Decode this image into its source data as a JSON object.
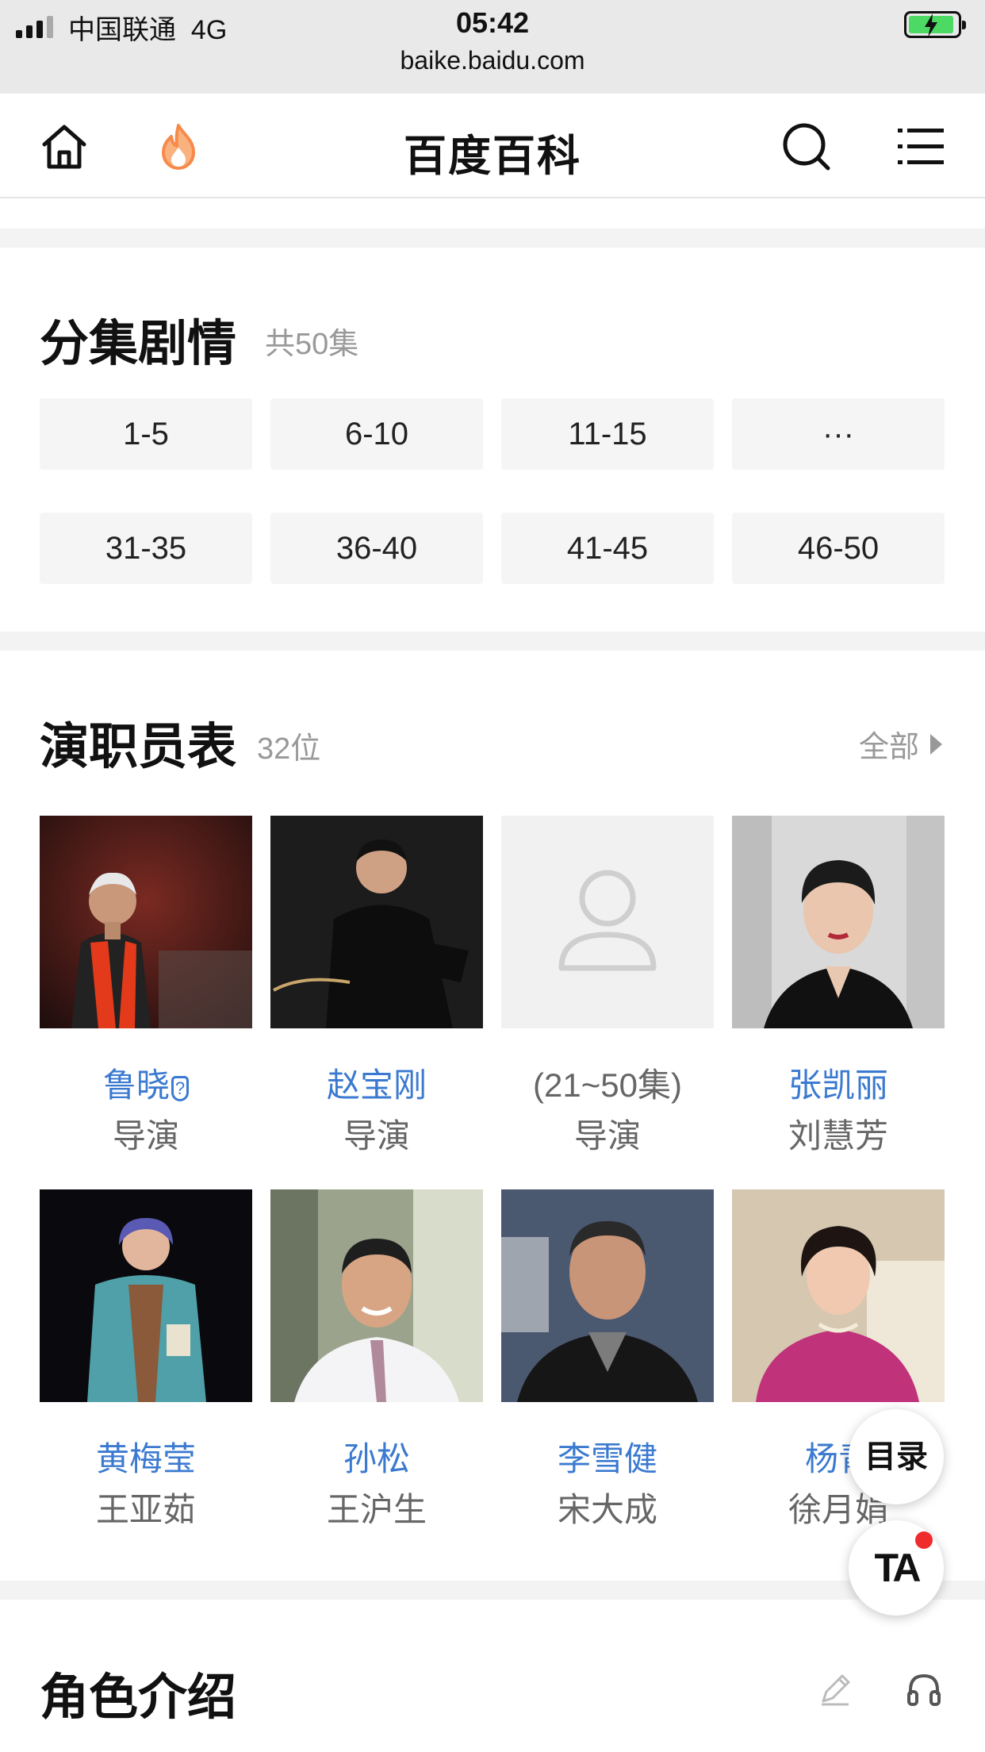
{
  "status_bar": {
    "carrier": "中国联通",
    "network": "4G",
    "time": "05:42",
    "url": "baike.baidu.com"
  },
  "nav": {
    "title": "百度百科",
    "icons": [
      "home-icon",
      "flame-icon",
      "search-icon",
      "menu-icon"
    ],
    "flame_color": "#f58a4a"
  },
  "episodes": {
    "title": "分集剧情",
    "count": "共50集",
    "buttons": [
      "1-5",
      "6-10",
      "11-15",
      "···",
      "31-35",
      "36-40",
      "41-45",
      "46-50"
    ]
  },
  "cast": {
    "title": "演职员表",
    "count": "32位",
    "all_label": "全部",
    "link_color": "#3b7ad0",
    "members": [
      {
        "name": "鲁晓",
        "role": "导演",
        "badge": "?"
      },
      {
        "name": "赵宝刚",
        "role": "导演"
      },
      {
        "name": "(21~50集)",
        "role": "导演"
      },
      {
        "name": "张凯丽",
        "role": "刘慧芳"
      },
      {
        "name": "黄梅莹",
        "role": "王亚茹"
      },
      {
        "name": "孙松",
        "role": "王沪生"
      },
      {
        "name": "李雪健",
        "role": "宋大成"
      },
      {
        "name": "杨青",
        "role": "徐月娟"
      }
    ]
  },
  "roles": {
    "title": "角色介绍"
  },
  "floating": {
    "toc_label": "目录",
    "ta_label": "TA"
  }
}
